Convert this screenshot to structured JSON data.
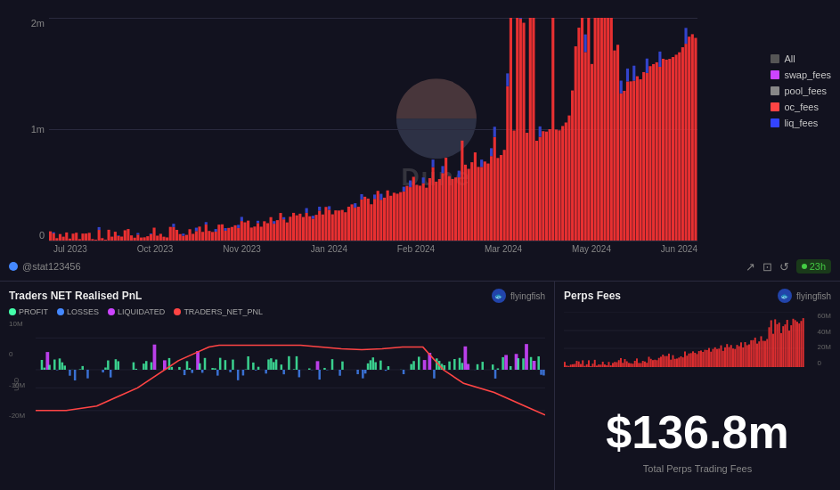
{
  "topChart": {
    "title": "Perps Fees",
    "yLabels": [
      "2m",
      "1m",
      "0"
    ],
    "xLabels": [
      "Jul 2023",
      "Oct 2023",
      "Nov 2023",
      "Jan 2024",
      "Feb 2024",
      "Mar 2024",
      "May 2024",
      "Jun 2024"
    ],
    "legend": [
      {
        "label": "All",
        "color": "#555555"
      },
      {
        "label": "swap_fees",
        "color": "#cc44ff"
      },
      {
        "label": "pool_fees",
        "color": "#888888"
      },
      {
        "label": "oc_fees",
        "color": "#ff4444"
      },
      {
        "label": "liq_fees",
        "color": "#3344ff"
      }
    ],
    "watermark": "Dune"
  },
  "bottomBar": {
    "user": "@stat123456",
    "timer": "23h",
    "icons": [
      "share-icon",
      "camera-icon",
      "refresh-icon"
    ]
  },
  "leftPanel": {
    "title": "Traders NET Realised PnL",
    "author": "flyingfish",
    "legend": [
      {
        "label": "PROFIT",
        "color": "#44ffaa"
      },
      {
        "label": "LOSSES",
        "color": "#4488ff"
      },
      {
        "label": "LIQUIDATED",
        "color": "#cc44ff"
      },
      {
        "label": "TRADERS_NET_PNL",
        "color": "#ff4444"
      }
    ],
    "yLabels": [
      "10M",
      "0",
      "-10M",
      "-20M"
    ],
    "xLabels": [],
    "yAxisTitle": "USD"
  },
  "rightPanel": {
    "title": "Perps Fees",
    "author": "flyingfish",
    "bigNumber": "$136.8m",
    "bigLabel": "Total Perps Trading Fees",
    "yLabels": [
      "60M",
      "40M",
      "20M",
      "0"
    ]
  }
}
